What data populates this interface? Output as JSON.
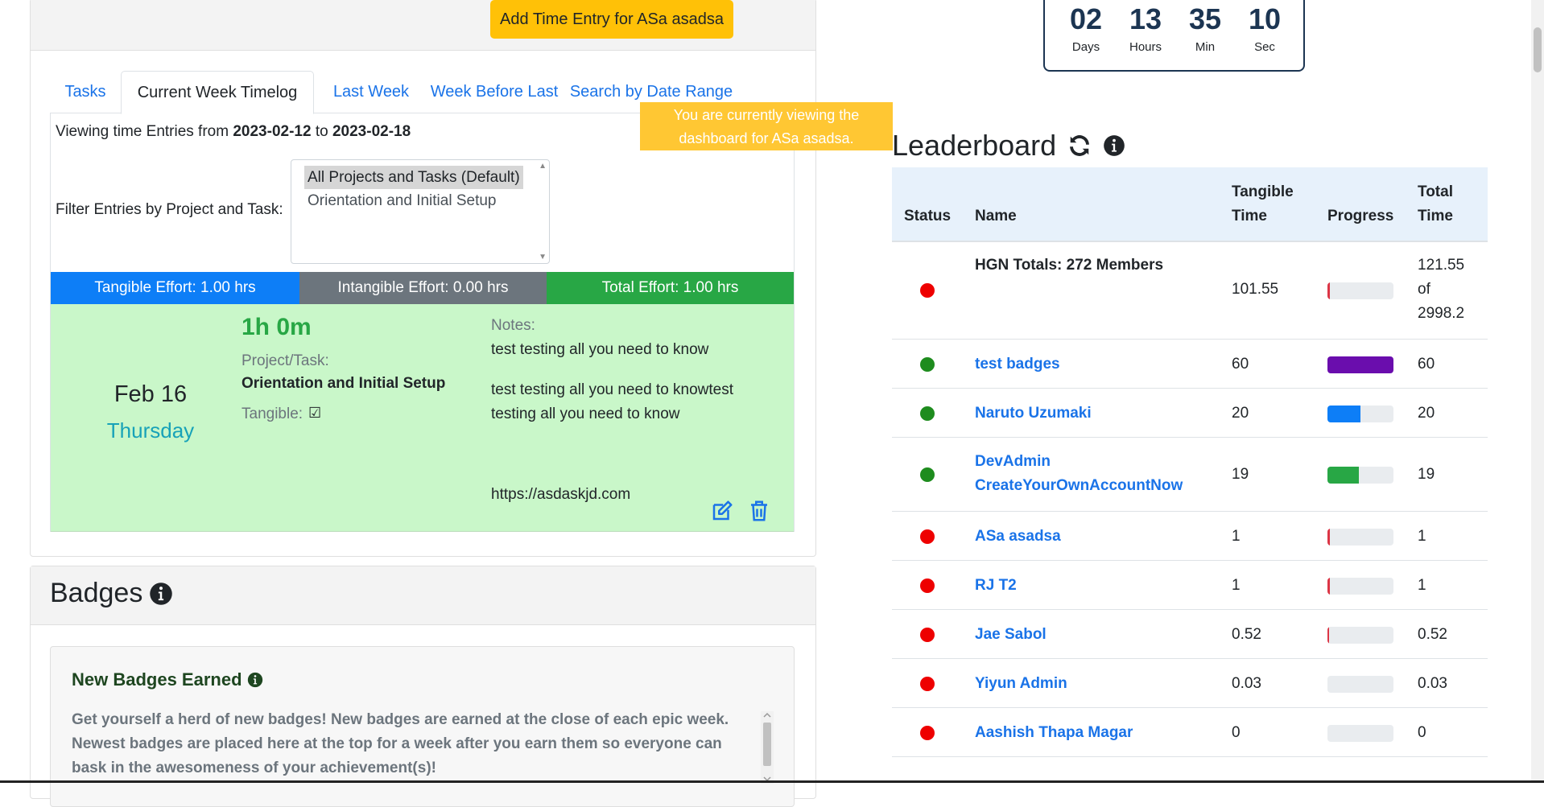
{
  "timelog": {
    "add_entry_label": "Add Time Entry for ASa asadsa",
    "tabs": [
      "Tasks",
      "Current Week Timelog",
      "Last Week",
      "Week Before Last",
      "Search by Date Range"
    ],
    "active_tab": "Current Week Timelog",
    "range_prefix": "Viewing time Entries from",
    "range_from": "2023-02-12",
    "range_to_word": "to",
    "range_to": "2023-02-18",
    "filter_label": "Filter Entries by Project and Task:",
    "filter_options": [
      "All Projects and Tasks (Default)",
      "Orientation and Initial Setup"
    ],
    "effort": {
      "tangible": "Tangible Effort: 1.00 hrs",
      "intangible": "Intangible Effort: 0.00 hrs",
      "total": "Total Effort: 1.00 hrs"
    },
    "entry": {
      "date": "Feb 16",
      "day": "Thursday",
      "duration": "1h 0m",
      "project_label": "Project/Task:",
      "project": "Orientation and Initial Setup",
      "tangible_label": "Tangible:",
      "tangible_check": "☑",
      "notes_label": "Notes:",
      "notes": [
        "test testing all you need to know",
        "test testing all you need to knowtest",
        "testing all you need to know",
        "https://asdaskjd.com"
      ]
    }
  },
  "toast": {
    "line1": "You are currently viewing the",
    "line2": "dashboard for ASa asadsa."
  },
  "badges": {
    "title": "Badges",
    "new_title": "New Badges Earned",
    "new_text": "Get yourself a herd of new badges! New badges are earned at the close of each epic week. Newest badges are placed here at the top for a week after you earn them so everyone can bask in the awesomeness of your achievement(s)!"
  },
  "countdown": [
    {
      "value": "02",
      "label": "Days"
    },
    {
      "value": "13",
      "label": "Hours"
    },
    {
      "value": "35",
      "label": "Min"
    },
    {
      "value": "10",
      "label": "Sec"
    }
  ],
  "leaderboard": {
    "title": "Leaderboard",
    "headers": {
      "status": "Status",
      "name": "Name",
      "tangible1": "Tangible",
      "tangible2": "Time",
      "progress": "Progress",
      "total1": "Total",
      "total2": "Time"
    },
    "totals": {
      "name": "HGN Totals: 272 Members",
      "tangible": "101.55",
      "total1": "121.55",
      "total2": "of",
      "total3": "2998.2",
      "progress": 0.04
    },
    "rows": [
      {
        "name": "test badges",
        "tangible": "60",
        "total": "60",
        "status": "green",
        "progress": 1.0,
        "progress_color": "#6a0dad"
      },
      {
        "name": "Naruto Uzumaki",
        "tangible": "20",
        "total": "20",
        "status": "green",
        "progress": 0.5,
        "progress_color": "#0d7ef7"
      },
      {
        "name": "DevAdmin CreateYourOwnAccountNow",
        "tangible": "19",
        "total": "19",
        "status": "green",
        "progress": 0.48,
        "progress_color": "#28a745"
      },
      {
        "name": "ASa asadsa",
        "tangible": "1",
        "total": "1",
        "status": "red",
        "progress": 0.04,
        "progress_color": "#dc3545"
      },
      {
        "name": "RJ T2",
        "tangible": "1",
        "total": "1",
        "status": "red",
        "progress": 0.04,
        "progress_color": "#dc3545"
      },
      {
        "name": "Jae Sabol",
        "tangible": "0.52",
        "total": "0.52",
        "status": "red",
        "progress": 0.02,
        "progress_color": "#dc3545"
      },
      {
        "name": "Yiyun Admin",
        "tangible": "0.03",
        "total": "0.03",
        "status": "red",
        "progress": 0.0,
        "progress_color": "#dc3545"
      },
      {
        "name": "Aashish Thapa Magar",
        "tangible": "0",
        "total": "0",
        "status": "red",
        "progress": 0.0,
        "progress_color": "#dc3545"
      }
    ],
    "status_colors": {
      "green": "#1e8c1e",
      "red": "#ee0000"
    }
  }
}
